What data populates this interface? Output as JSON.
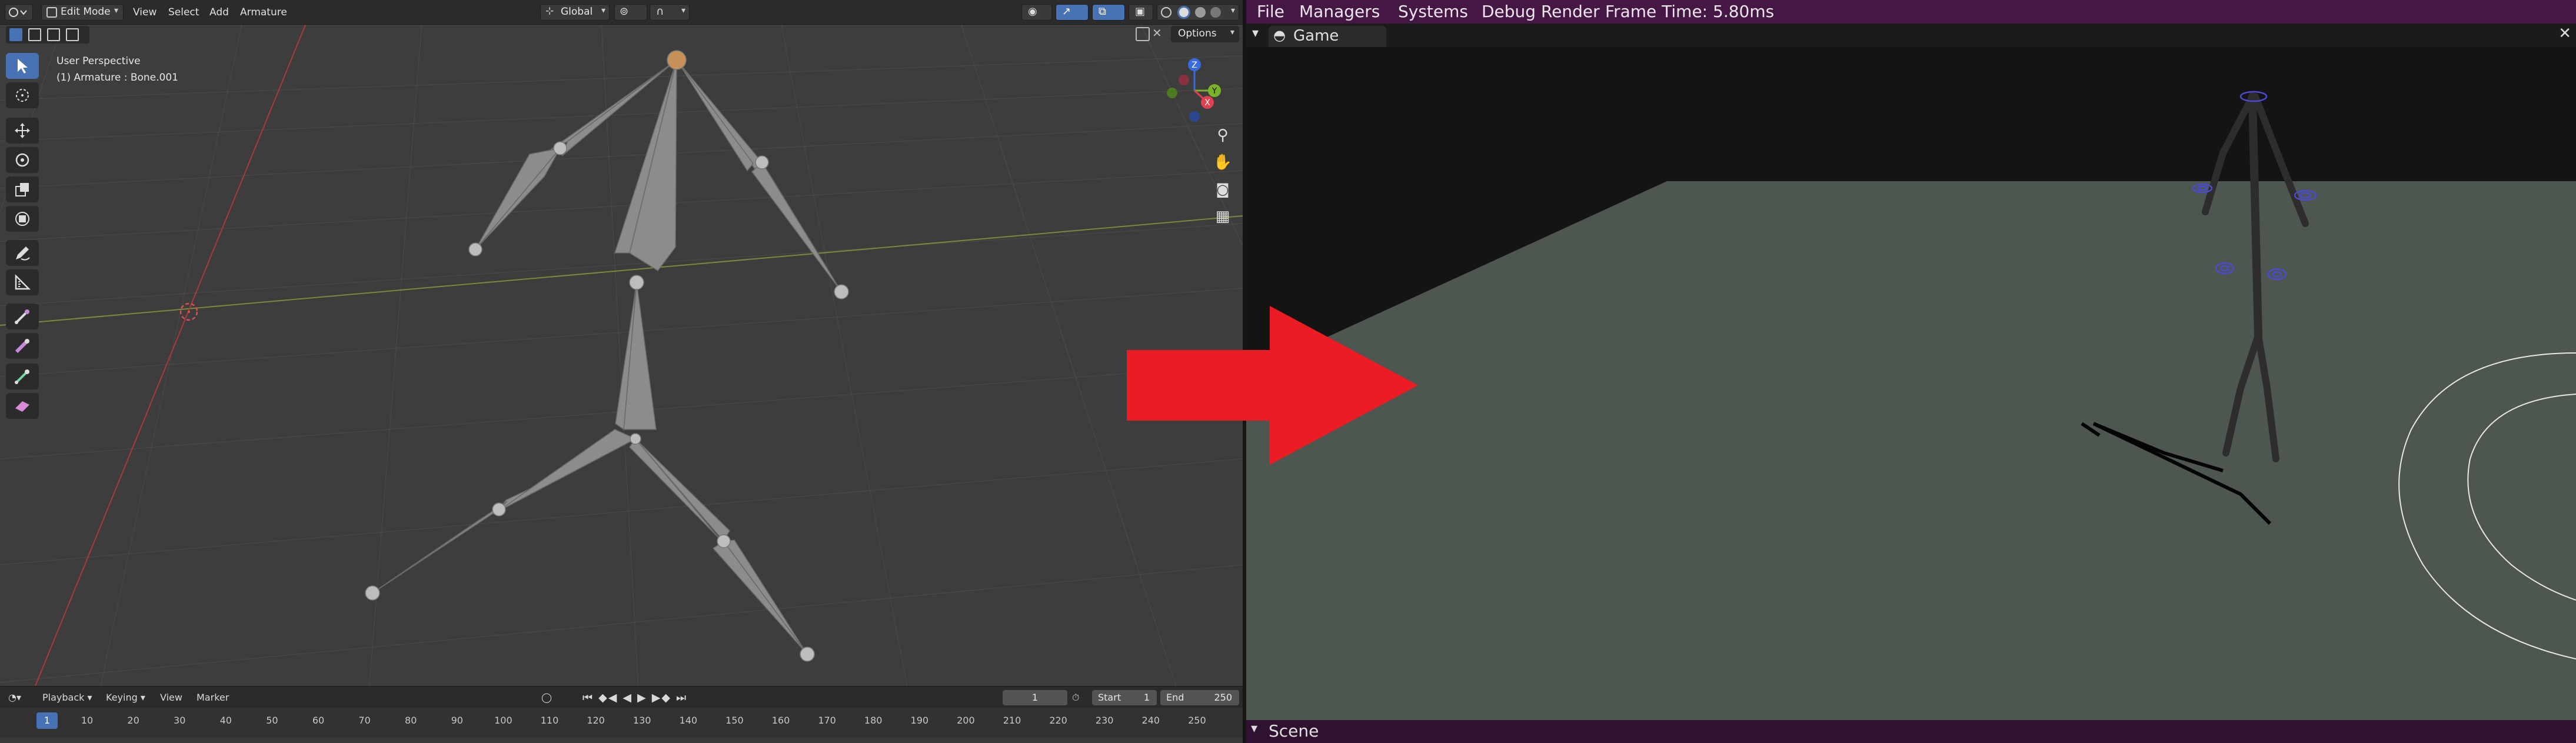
{
  "editor": {
    "header": {
      "mode": "Edit Mode",
      "menus": [
        "View",
        "Select",
        "Add",
        "Armature"
      ],
      "transform_orientation": "Global",
      "options_label": "Options"
    },
    "viewport": {
      "perspective": "User Perspective",
      "active_object": "(1) Armature : Bone.001"
    },
    "gizmo": {
      "x": "X",
      "y": "Y",
      "z": "Z"
    },
    "timeline": {
      "menus": [
        "Playback",
        "Keying",
        "View",
        "Marker"
      ],
      "current_frame": "1",
      "start_label": "Start",
      "start_value": "1",
      "end_label": "End",
      "end_value": "250",
      "frame_indicator": "1",
      "ticks": [
        "10",
        "20",
        "30",
        "40",
        "50",
        "60",
        "70",
        "80",
        "90",
        "100",
        "110",
        "120",
        "130",
        "140",
        "150",
        "160",
        "170",
        "180",
        "190",
        "200",
        "210",
        "220",
        "230",
        "240",
        "250"
      ]
    }
  },
  "engine": {
    "menubar": {
      "file": "File",
      "managers": "Managers",
      "systems": "Systems",
      "debug_render": "Debug Render",
      "frame_time": "Frame Time: 5.80ms"
    },
    "game_window": {
      "title": "Game"
    },
    "scene_panel": {
      "title": "Scene"
    }
  },
  "colors": {
    "accent_blue": "#4772b3",
    "engine_menubar": "#441744",
    "arrow_red": "#ec1c24",
    "ground": "#4e5650",
    "bone_gray": "#8a8a8a"
  }
}
